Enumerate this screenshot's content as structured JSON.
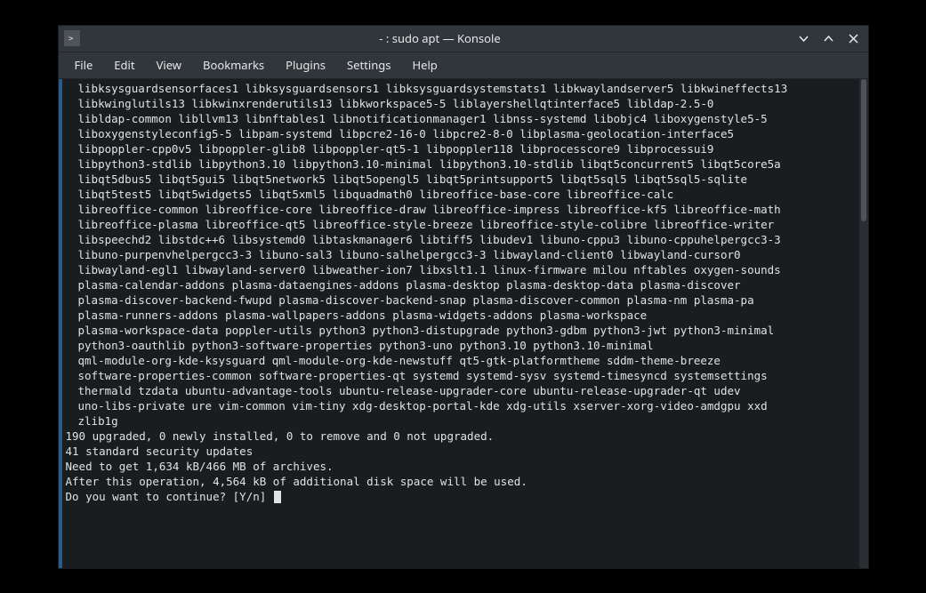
{
  "window": {
    "title": "- : sudo apt — Konsole"
  },
  "menubar": {
    "items": [
      "File",
      "Edit",
      "View",
      "Bookmarks",
      "Plugins",
      "Settings",
      "Help"
    ]
  },
  "terminal": {
    "package_lines": [
      "libksysguardsensorfaces1 libksysguardsensors1 libksysguardsystemstats1 libkwaylandserver5 libkwineffects13",
      "libkwinglutils13 libkwinxrenderutils13 libkworkspace5-5 liblayershellqtinterface5 libldap-2.5-0",
      "libldap-common libllvm13 libnftables1 libnotificationmanager1 libnss-systemd libobjc4 liboxygenstyle5-5",
      "liboxygenstyleconfig5-5 libpam-systemd libpcre2-16-0 libpcre2-8-0 libplasma-geolocation-interface5",
      "libpoppler-cpp0v5 libpoppler-glib8 libpoppler-qt5-1 libpoppler118 libprocesscore9 libprocessui9",
      "libpython3-stdlib libpython3.10 libpython3.10-minimal libpython3.10-stdlib libqt5concurrent5 libqt5core5a",
      "libqt5dbus5 libqt5gui5 libqt5network5 libqt5opengl5 libqt5printsupport5 libqt5sql5 libqt5sql5-sqlite",
      "libqt5test5 libqt5widgets5 libqt5xml5 libquadmath0 libreoffice-base-core libreoffice-calc",
      "libreoffice-common libreoffice-core libreoffice-draw libreoffice-impress libreoffice-kf5 libreoffice-math",
      "libreoffice-plasma libreoffice-qt5 libreoffice-style-breeze libreoffice-style-colibre libreoffice-writer",
      "libspeechd2 libstdc++6 libsystemd0 libtaskmanager6 libtiff5 libudev1 libuno-cppu3 libuno-cppuhelpergcc3-3",
      "libuno-purpenvhelpergcc3-3 libuno-sal3 libuno-salhelpergcc3-3 libwayland-client0 libwayland-cursor0",
      "libwayland-egl1 libwayland-server0 libweather-ion7 libxslt1.1 linux-firmware milou nftables oxygen-sounds",
      "plasma-calendar-addons plasma-dataengines-addons plasma-desktop plasma-desktop-data plasma-discover",
      "plasma-discover-backend-fwupd plasma-discover-backend-snap plasma-discover-common plasma-nm plasma-pa",
      "plasma-runners-addons plasma-wallpapers-addons plasma-widgets-addons plasma-workspace",
      "plasma-workspace-data poppler-utils python3 python3-distupgrade python3-gdbm python3-jwt python3-minimal",
      "python3-oauthlib python3-software-properties python3-uno python3.10 python3.10-minimal",
      "qml-module-org-kde-ksysguard qml-module-org-kde-newstuff qt5-gtk-platformtheme sddm-theme-breeze",
      "software-properties-common software-properties-qt systemd systemd-sysv systemd-timesyncd systemsettings",
      "thermald tzdata ubuntu-advantage-tools ubuntu-release-upgrader-core ubuntu-release-upgrader-qt udev",
      "uno-libs-private ure vim-common vim-tiny xdg-desktop-portal-kde xdg-utils xserver-xorg-video-amdgpu xxd",
      "zlib1g"
    ],
    "status_lines": [
      "190 upgraded, 0 newly installed, 0 to remove and 0 not upgraded.",
      "41 standard security updates",
      "Need to get 1,634 kB/466 MB of archives.",
      "After this operation, 4,564 kB of additional disk space will be used."
    ],
    "prompt": "Do you want to continue? [Y/n] "
  }
}
